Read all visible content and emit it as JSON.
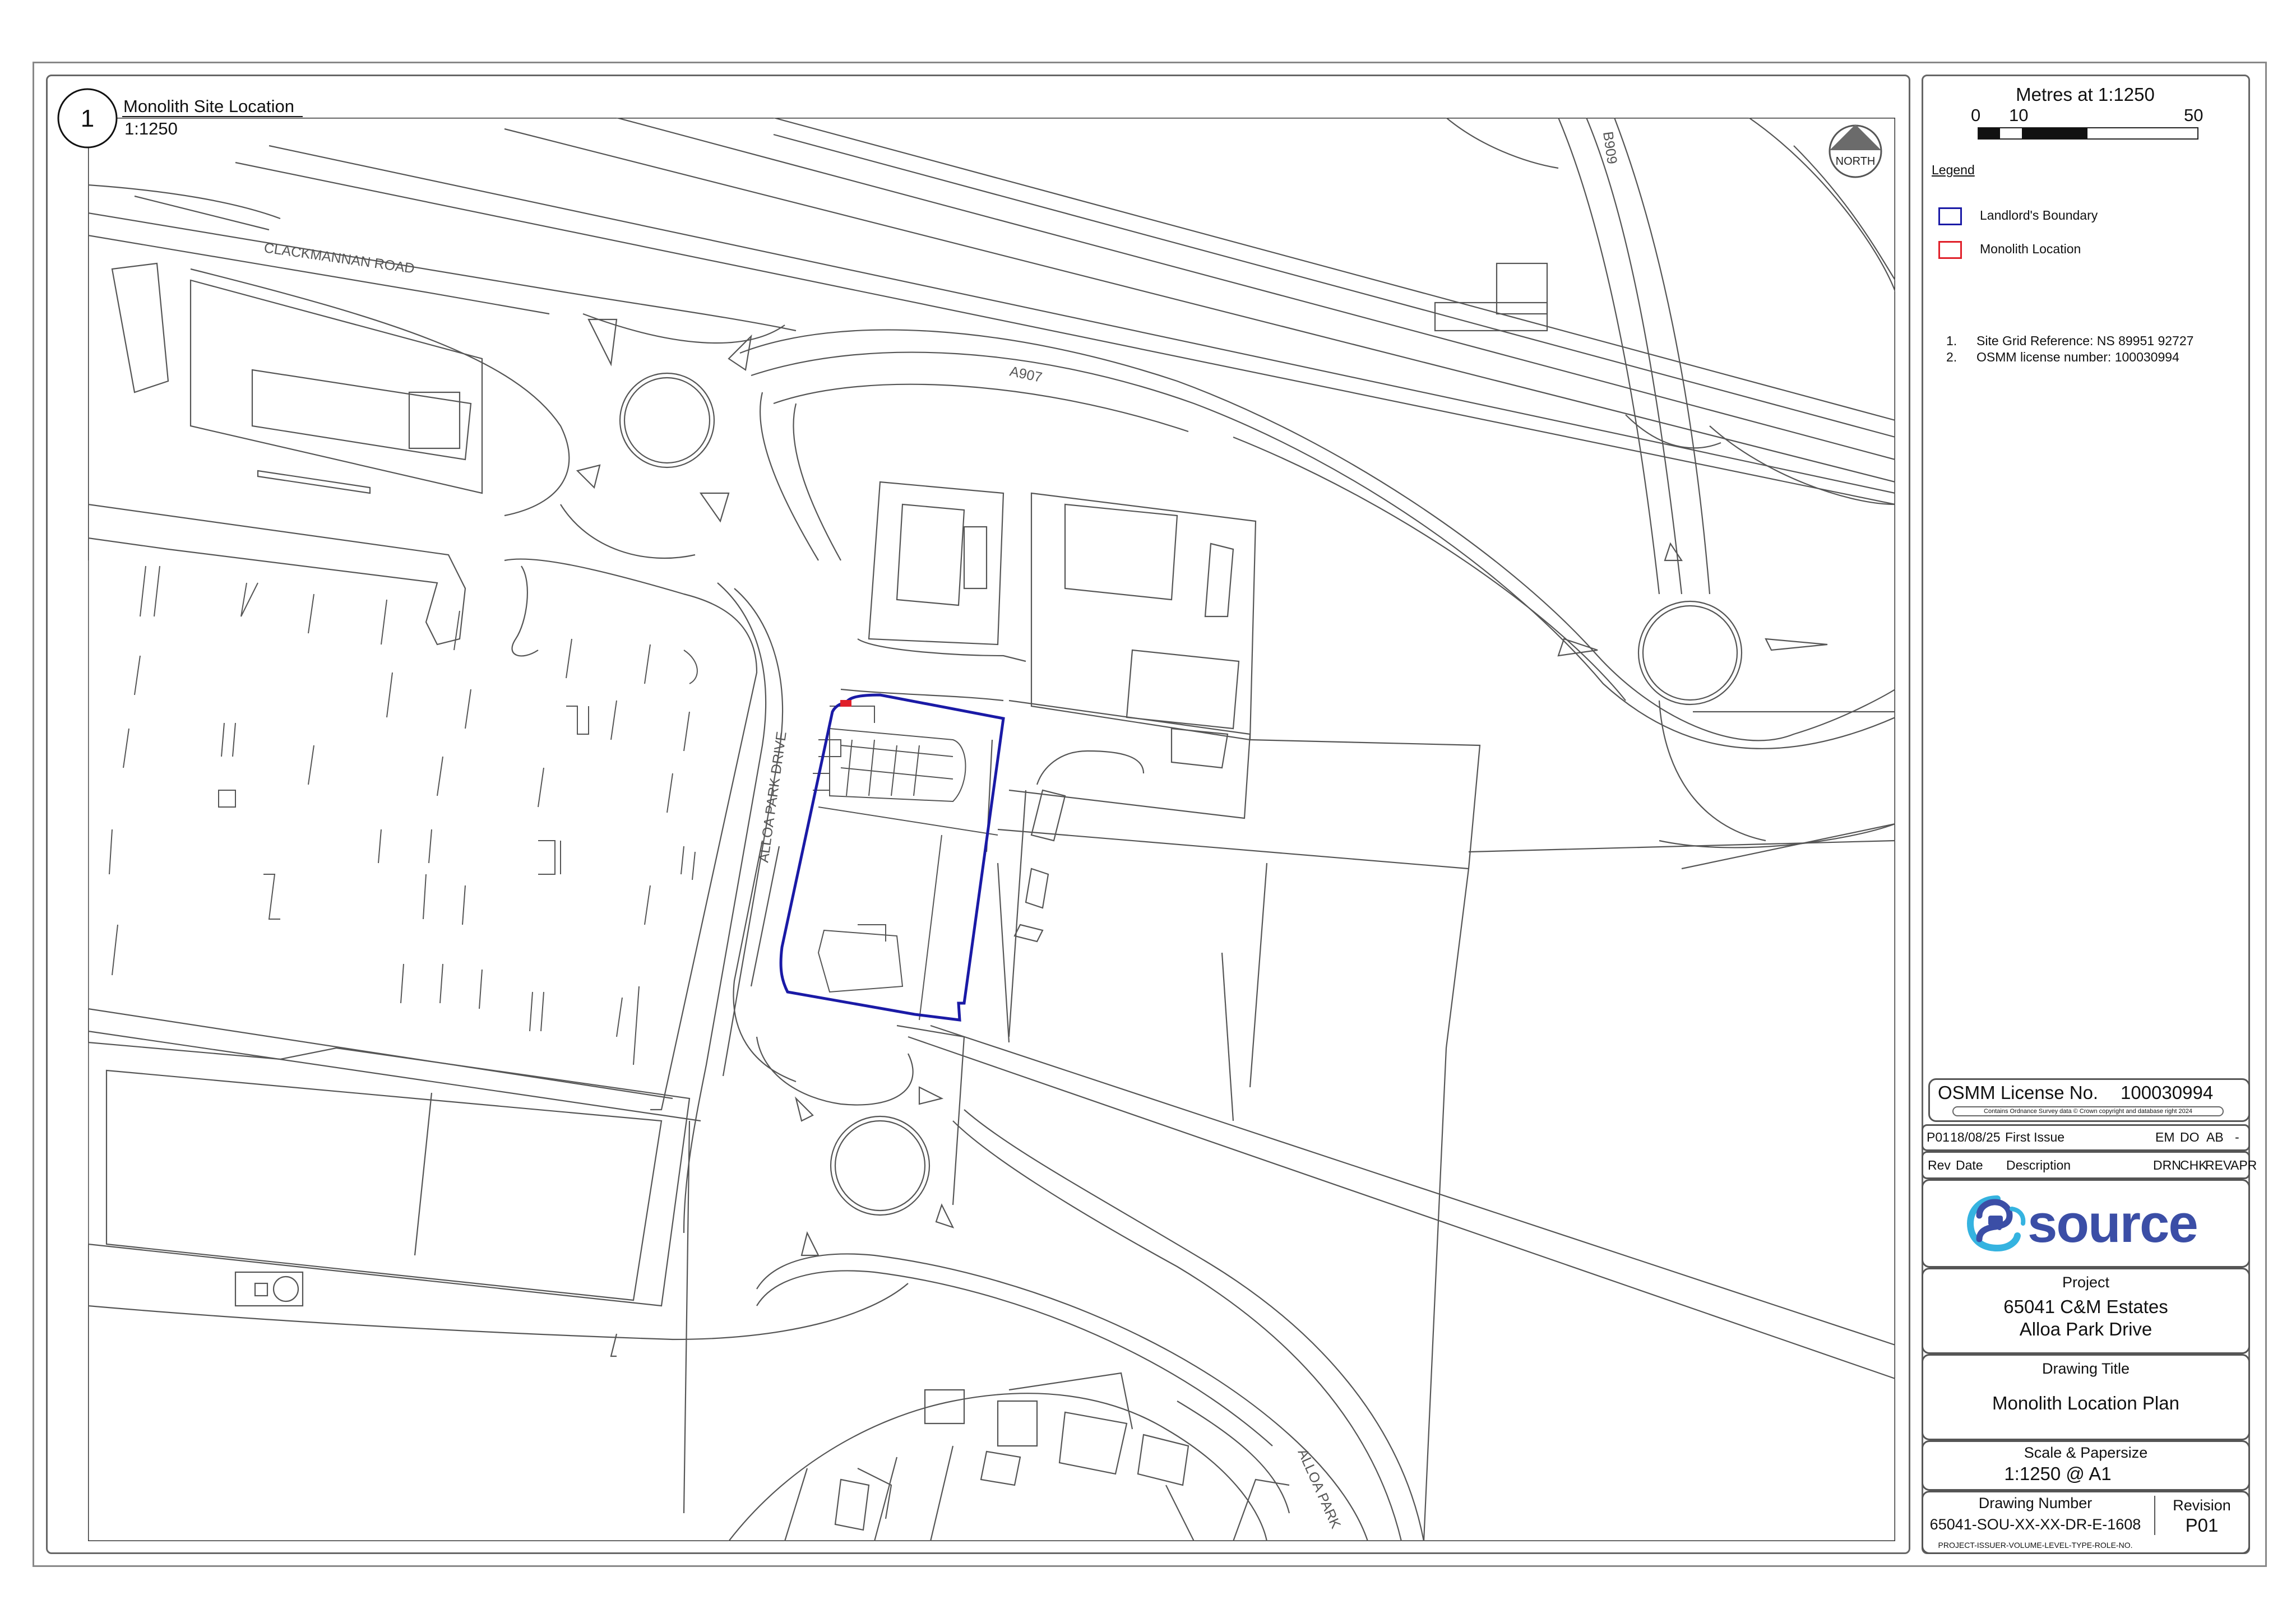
{
  "map": {
    "view_number": "1",
    "view_title": "Monolith Site Location",
    "view_scale": "1:1250",
    "north_label": "NORTH",
    "road_labels": {
      "clackmannan_road": "CLACKMANNAN ROAD",
      "a907": "A907",
      "b909": "B909",
      "alloa_park_drive": "ALLOA PARK DRIVE",
      "alloa_park": "ALLOA PARK"
    },
    "landlord_boundary_color": "#1a1aa6",
    "monolith_location_color": "#e0202a"
  },
  "scale_bar": {
    "title": "Metres at 1:1250",
    "ticks": [
      "0",
      "10",
      "50"
    ]
  },
  "legend": {
    "heading": "Legend",
    "items": [
      {
        "label": "Landlord's Boundary",
        "color": "#1a1aa6"
      },
      {
        "label": "Monolith Location",
        "color": "#e0202a"
      }
    ]
  },
  "notes": [
    {
      "num": "1.",
      "text": "Site Grid Reference: NS 89951 92727"
    },
    {
      "num": "2.",
      "text": "OSMM license number: 100030994"
    }
  ],
  "title_block": {
    "osmm_label": "OSMM License No.",
    "osmm_number": "100030994",
    "copyright": "Contains Ordnance Survey data © Crown copyright and database right 2024",
    "revision_row": {
      "rev": "P01",
      "date": "18/08/25",
      "description": "First Issue",
      "drn": "EM",
      "chk": "DO",
      "rev_by": "AB",
      "apr": "-"
    },
    "revision_headers": {
      "rev": "Rev",
      "date": "Date",
      "description": "Description",
      "drn": "DRN",
      "chk": "CHK",
      "rev_by": "REV",
      "apr": "APR"
    },
    "logo_text": "source",
    "project_label": "Project",
    "project_line1": "65041 C&M Estates",
    "project_line2": "Alloa Park Drive",
    "drawing_title_label": "Drawing Title",
    "drawing_title": "Monolith Location Plan",
    "scale_label": "Scale & Papersize",
    "scale_value": "1:1250 @ A1",
    "drawing_number_label": "Drawing Number",
    "drawing_number": "65041-SOU-XX-XX-DR-E-1608",
    "revision_label": "Revision",
    "revision_value": "P01",
    "naming_convention": "PROJECT-ISSUER-VOLUME-LEVEL-TYPE-ROLE-NO."
  }
}
